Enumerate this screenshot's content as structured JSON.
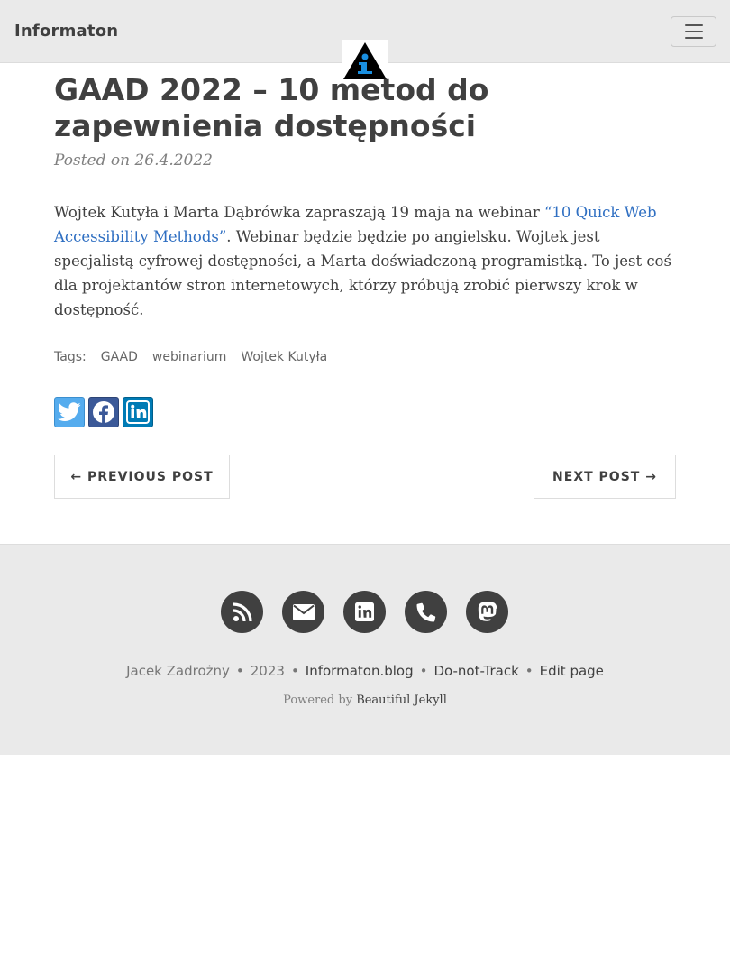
{
  "navbar": {
    "brand": "Informaton",
    "logo_icon": "informaton-logo-icon",
    "menu_icon": "hamburger-menu-icon"
  },
  "post": {
    "title": "GAAD 2022 – 10 metod do zapewnienia dostępności",
    "meta": "Posted on 26.4.2022",
    "body_before_link": "Wojtek Kutyła i Marta Dąbrówka zapraszają 19 maja na webinar ",
    "link_text": "“10 Quick Web Accessibility Methods”",
    "body_after_link": ". Webinar będzie będzie po angielsku. Wojtek jest specjalistą cyfrowej dostępności, a Marta doświadczoną programistką. To jest coś dla projektantów stron internetowych, którzy próbują zrobić pierwszy krok w dostępność.",
    "tags_label": "Tags:",
    "tags": [
      "GAAD",
      "webinarium",
      "Wojtek Kutyła"
    ],
    "share": [
      "twitter-icon",
      "facebook-icon",
      "linkedin-icon"
    ],
    "prev_label": "← PREVIOUS POST",
    "next_label": "NEXT POST →"
  },
  "footer": {
    "social": [
      "rss-icon",
      "envelope-icon",
      "linkedin-icon",
      "phone-icon",
      "mastodon-icon"
    ],
    "author": "Jacek Zadrożny",
    "year": "2023",
    "site_link": "Informaton.blog",
    "dnt_link": "Do-not-Track",
    "edit_link": "Edit page",
    "powered_by": "Powered by",
    "powered_link": "Beautiful Jekyll"
  },
  "colors": {
    "navbar_bg": "#eaeaea",
    "link": "#2f6fc2",
    "text": "#404040",
    "twitter": "#55acee",
    "facebook": "#3b5998",
    "linkedin": "#007bb5"
  }
}
